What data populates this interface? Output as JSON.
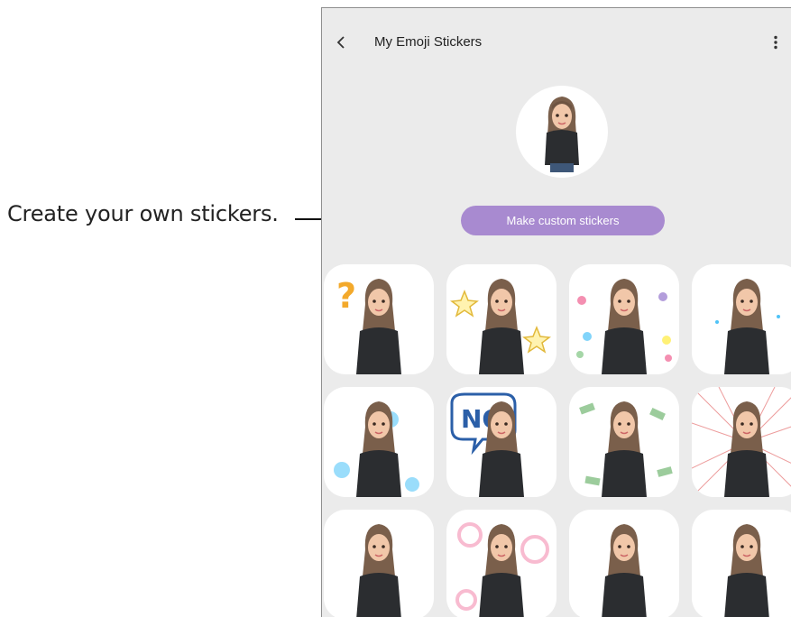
{
  "callout": {
    "text": "Create your own stickers."
  },
  "app": {
    "title": "My Emoji Stickers",
    "back_icon": "chevron-left-icon",
    "menu_icon": "more-vertical-icon"
  },
  "profile": {
    "avatar_icon": "ar-emoji-avatar"
  },
  "actions": {
    "make_custom_label": "Make custom stickers",
    "accent_color": "#a88ad0"
  },
  "stickers": [
    {
      "name": "sticker-question",
      "icon": "question-mark-icon"
    },
    {
      "name": "sticker-stars",
      "icon": "star-icon"
    },
    {
      "name": "sticker-hearts",
      "icon": "heart-icon"
    },
    {
      "name": "sticker-shy",
      "icon": "hands-face-icon"
    },
    {
      "name": "sticker-sad",
      "icon": "sad-face-icon"
    },
    {
      "name": "sticker-no",
      "icon": "speech-bubble-icon",
      "bubble_text": "NO"
    },
    {
      "name": "sticker-money",
      "icon": "money-icon"
    },
    {
      "name": "sticker-angry",
      "icon": "burst-icon"
    },
    {
      "name": "sticker-wave",
      "icon": "wave-hand-icon"
    },
    {
      "name": "sticker-bubbles",
      "icon": "bubble-icon"
    },
    {
      "name": "sticker-shrug",
      "icon": "shrug-icon"
    },
    {
      "name": "sticker-thumbs",
      "icon": "thumbs-up-icon"
    }
  ]
}
